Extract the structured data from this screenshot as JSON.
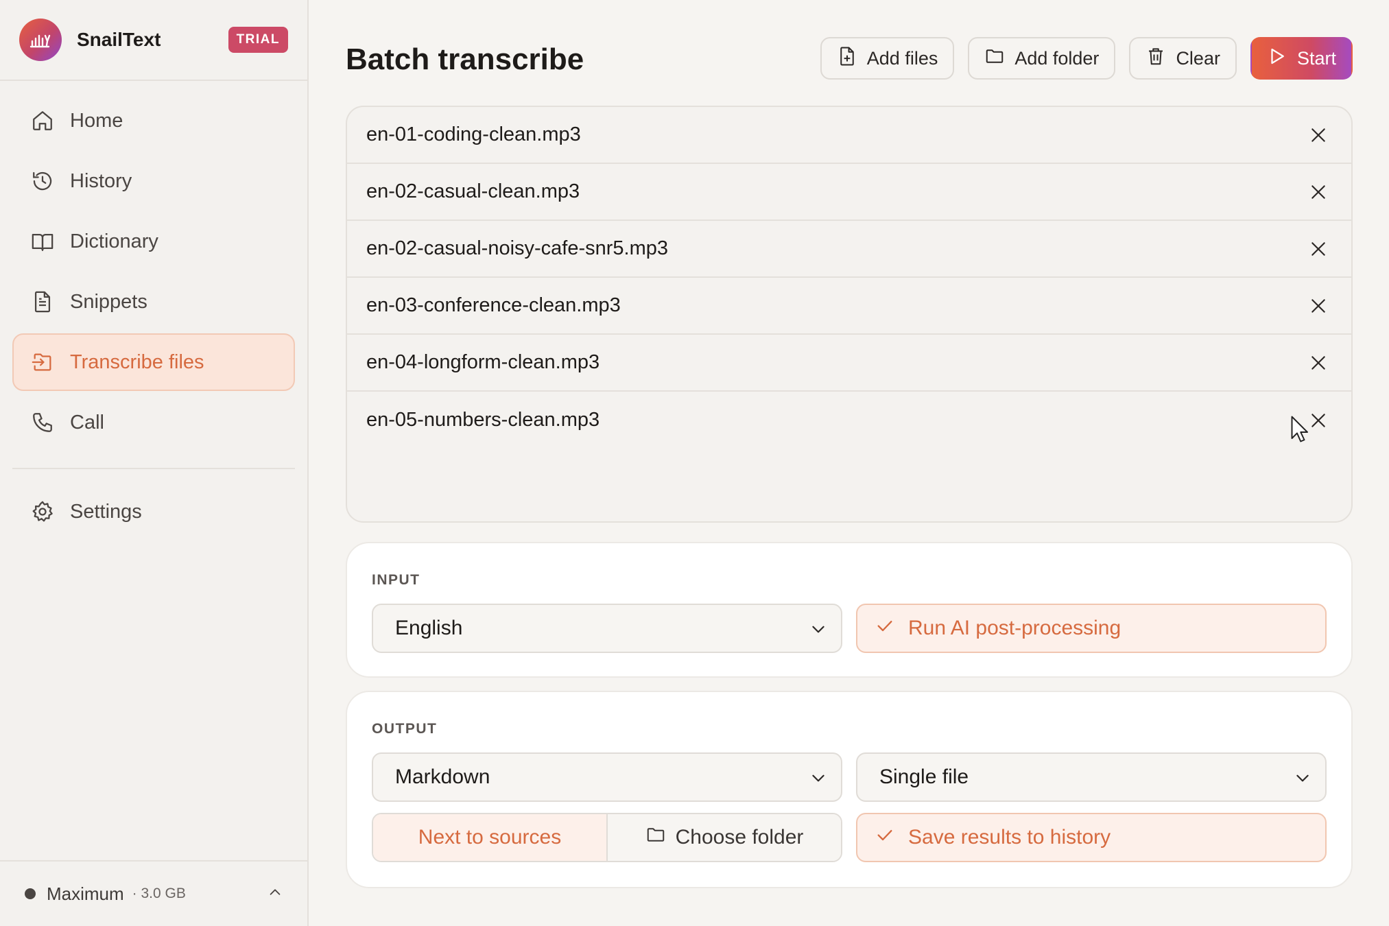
{
  "app": {
    "name": "SnailText",
    "badge": "TRIAL"
  },
  "sidebar": {
    "items": [
      {
        "label": "Home",
        "icon": "home-icon"
      },
      {
        "label": "History",
        "icon": "history-icon"
      },
      {
        "label": "Dictionary",
        "icon": "book-icon"
      },
      {
        "label": "Snippets",
        "icon": "document-icon"
      },
      {
        "label": "Transcribe files",
        "icon": "file-import-icon",
        "active": true
      },
      {
        "label": "Call",
        "icon": "phone-icon"
      }
    ],
    "settings": {
      "label": "Settings",
      "icon": "gear-icon"
    },
    "footer": {
      "mode": "Maximum",
      "size": "· 3.0 GB"
    }
  },
  "page": {
    "title": "Batch transcribe",
    "actions": {
      "add_files": "Add files",
      "add_folder": "Add folder",
      "clear": "Clear",
      "start": "Start"
    }
  },
  "files": [
    "en-01-coding-clean.mp3",
    "en-02-casual-clean.mp3",
    "en-02-casual-noisy-cafe-snr5.mp3",
    "en-03-conference-clean.mp3",
    "en-04-longform-clean.mp3",
    "en-05-numbers-clean.mp3"
  ],
  "input": {
    "label": "INPUT",
    "language": "English",
    "post_processing": "Run AI post-processing"
  },
  "output": {
    "label": "OUTPUT",
    "format": "Markdown",
    "mode": "Single file",
    "location_next": "Next to sources",
    "location_choose": "Choose folder",
    "save_history": "Save results to history"
  },
  "colors": {
    "accent": "#d66a3f",
    "accent_bg": "#fbe5da",
    "trial": "#cc4a66"
  }
}
